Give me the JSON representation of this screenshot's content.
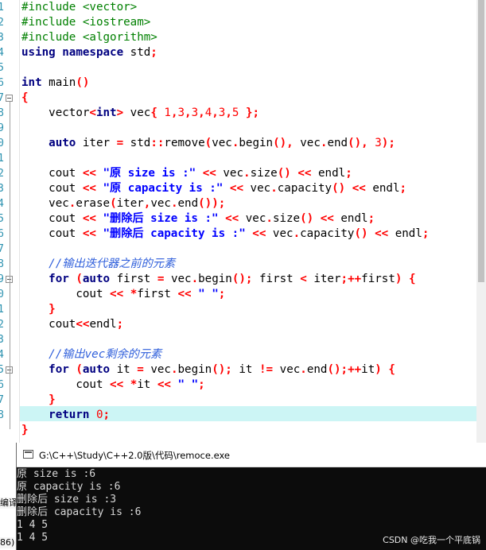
{
  "editor": {
    "lines": [
      [
        [
          "pp",
          "#include <vector>"
        ]
      ],
      [
        [
          "pp",
          "#include <iostream>"
        ]
      ],
      [
        [
          "pp",
          "#include <algorithm>"
        ]
      ],
      [
        [
          "kw",
          "using namespace"
        ],
        [
          "t",
          " std"
        ],
        [
          "op",
          ";"
        ]
      ],
      [],
      [
        [
          "kw",
          "int"
        ],
        [
          "t",
          " main"
        ],
        [
          "op",
          "()"
        ]
      ],
      [
        [
          "op",
          "{"
        ]
      ],
      [
        [
          "t",
          "    vector"
        ],
        [
          "op",
          "<"
        ],
        [
          "kw",
          "int"
        ],
        [
          "op",
          ">"
        ],
        [
          "t",
          " vec"
        ],
        [
          "op",
          "{"
        ],
        [
          "t",
          " "
        ],
        [
          "num",
          "1"
        ],
        [
          "op",
          ","
        ],
        [
          "num",
          "3"
        ],
        [
          "op",
          ","
        ],
        [
          "num",
          "3"
        ],
        [
          "op",
          ","
        ],
        [
          "num",
          "4"
        ],
        [
          "op",
          ","
        ],
        [
          "num",
          "3"
        ],
        [
          "op",
          ","
        ],
        [
          "num",
          "5"
        ],
        [
          "t",
          " "
        ],
        [
          "op",
          "};"
        ]
      ],
      [],
      [
        [
          "t",
          "    "
        ],
        [
          "kw",
          "auto"
        ],
        [
          "t",
          " iter "
        ],
        [
          "op",
          "="
        ],
        [
          "t",
          " std"
        ],
        [
          "op",
          "::"
        ],
        [
          "t",
          "remove"
        ],
        [
          "op",
          "("
        ],
        [
          "t",
          "vec"
        ],
        [
          "op",
          "."
        ],
        [
          "t",
          "begin"
        ],
        [
          "op",
          "(),"
        ],
        [
          "t",
          " vec"
        ],
        [
          "op",
          "."
        ],
        [
          "t",
          "end"
        ],
        [
          "op",
          "(),"
        ],
        [
          "t",
          " "
        ],
        [
          "num",
          "3"
        ],
        [
          "op",
          ");"
        ]
      ],
      [],
      [
        [
          "t",
          "    cout "
        ],
        [
          "op",
          "<<"
        ],
        [
          "t",
          " "
        ],
        [
          "str",
          "\"原 size is :\""
        ],
        [
          "t",
          " "
        ],
        [
          "op",
          "<<"
        ],
        [
          "t",
          " vec"
        ],
        [
          "op",
          "."
        ],
        [
          "t",
          "size"
        ],
        [
          "op",
          "()"
        ],
        [
          "t",
          " "
        ],
        [
          "op",
          "<<"
        ],
        [
          "t",
          " endl"
        ],
        [
          "op",
          ";"
        ]
      ],
      [
        [
          "t",
          "    cout "
        ],
        [
          "op",
          "<<"
        ],
        [
          "t",
          " "
        ],
        [
          "str",
          "\"原 capacity is :\""
        ],
        [
          "t",
          " "
        ],
        [
          "op",
          "<<"
        ],
        [
          "t",
          " vec"
        ],
        [
          "op",
          "."
        ],
        [
          "t",
          "capacity"
        ],
        [
          "op",
          "()"
        ],
        [
          "t",
          " "
        ],
        [
          "op",
          "<<"
        ],
        [
          "t",
          " endl"
        ],
        [
          "op",
          ";"
        ]
      ],
      [
        [
          "t",
          "    vec"
        ],
        [
          "op",
          "."
        ],
        [
          "t",
          "erase"
        ],
        [
          "op",
          "("
        ],
        [
          "t",
          "iter"
        ],
        [
          "op",
          ","
        ],
        [
          "t",
          "vec"
        ],
        [
          "op",
          "."
        ],
        [
          "t",
          "end"
        ],
        [
          "op",
          "());"
        ]
      ],
      [
        [
          "t",
          "    cout "
        ],
        [
          "op",
          "<<"
        ],
        [
          "t",
          " "
        ],
        [
          "str",
          "\"删除后 size is :\""
        ],
        [
          "t",
          " "
        ],
        [
          "op",
          "<<"
        ],
        [
          "t",
          " vec"
        ],
        [
          "op",
          "."
        ],
        [
          "t",
          "size"
        ],
        [
          "op",
          "()"
        ],
        [
          "t",
          " "
        ],
        [
          "op",
          "<<"
        ],
        [
          "t",
          " endl"
        ],
        [
          "op",
          ";"
        ]
      ],
      [
        [
          "t",
          "    cout "
        ],
        [
          "op",
          "<<"
        ],
        [
          "t",
          " "
        ],
        [
          "str",
          "\"删除后 capacity is :\""
        ],
        [
          "t",
          " "
        ],
        [
          "op",
          "<<"
        ],
        [
          "t",
          " vec"
        ],
        [
          "op",
          "."
        ],
        [
          "t",
          "capacity"
        ],
        [
          "op",
          "()"
        ],
        [
          "t",
          " "
        ],
        [
          "op",
          "<<"
        ],
        [
          "t",
          " endl"
        ],
        [
          "op",
          ";"
        ]
      ],
      [],
      [
        [
          "t",
          "    "
        ],
        [
          "cm",
          "//输出迭代器之前的元素"
        ]
      ],
      [
        [
          "t",
          "    "
        ],
        [
          "kw",
          "for"
        ],
        [
          "t",
          " "
        ],
        [
          "op",
          "("
        ],
        [
          "kw",
          "auto"
        ],
        [
          "t",
          " first "
        ],
        [
          "op",
          "="
        ],
        [
          "t",
          " vec"
        ],
        [
          "op",
          "."
        ],
        [
          "t",
          "begin"
        ],
        [
          "op",
          "();"
        ],
        [
          "t",
          " first "
        ],
        [
          "op",
          "<"
        ],
        [
          "t",
          " iter"
        ],
        [
          "op",
          ";++"
        ],
        [
          "t",
          "first"
        ],
        [
          "op",
          ")"
        ],
        [
          "t",
          " "
        ],
        [
          "op",
          "{"
        ]
      ],
      [
        [
          "t",
          "        cout "
        ],
        [
          "op",
          "<<"
        ],
        [
          "t",
          " "
        ],
        [
          "op",
          "*"
        ],
        [
          "t",
          "first "
        ],
        [
          "op",
          "<<"
        ],
        [
          "t",
          " "
        ],
        [
          "str",
          "\" \""
        ],
        [
          "op",
          ";"
        ]
      ],
      [
        [
          "t",
          "    "
        ],
        [
          "op",
          "}"
        ]
      ],
      [
        [
          "t",
          "    cout"
        ],
        [
          "op",
          "<<"
        ],
        [
          "t",
          "endl"
        ],
        [
          "op",
          ";"
        ]
      ],
      [],
      [
        [
          "t",
          "    "
        ],
        [
          "cm",
          "//输出vec剩余的元素"
        ]
      ],
      [
        [
          "t",
          "    "
        ],
        [
          "kw",
          "for"
        ],
        [
          "t",
          " "
        ],
        [
          "op",
          "("
        ],
        [
          "kw",
          "auto"
        ],
        [
          "t",
          " it "
        ],
        [
          "op",
          "="
        ],
        [
          "t",
          " vec"
        ],
        [
          "op",
          "."
        ],
        [
          "t",
          "begin"
        ],
        [
          "op",
          "();"
        ],
        [
          "t",
          " it "
        ],
        [
          "op",
          "!="
        ],
        [
          "t",
          " vec"
        ],
        [
          "op",
          "."
        ],
        [
          "t",
          "end"
        ],
        [
          "op",
          "();++"
        ],
        [
          "t",
          "it"
        ],
        [
          "op",
          ")"
        ],
        [
          "t",
          " "
        ],
        [
          "op",
          "{"
        ]
      ],
      [
        [
          "t",
          "        cout "
        ],
        [
          "op",
          "<<"
        ],
        [
          "t",
          " "
        ],
        [
          "op",
          "*"
        ],
        [
          "t",
          "it "
        ],
        [
          "op",
          "<<"
        ],
        [
          "t",
          " "
        ],
        [
          "str",
          "\" \""
        ],
        [
          "op",
          ";"
        ]
      ],
      [
        [
          "t",
          "    "
        ],
        [
          "op",
          "}"
        ]
      ],
      [
        [
          "t",
          "    "
        ],
        [
          "kw",
          "return"
        ],
        [
          "t",
          " "
        ],
        [
          "num",
          "0"
        ],
        [
          "op",
          ";"
        ]
      ],
      [
        [
          "op",
          "}"
        ]
      ]
    ],
    "gutter_numbers": [
      "1",
      "2",
      "3",
      "4",
      "5",
      "6",
      "7",
      "8",
      "9",
      "0",
      "1",
      "2",
      "3",
      "4",
      "5",
      "6",
      "7",
      "8",
      "9",
      "0",
      "1",
      "2",
      "3",
      "4",
      "5",
      "6",
      "7",
      "8"
    ]
  },
  "side_labels": {
    "compile": "编译",
    "paren": "86)"
  },
  "console": {
    "title": "G:\\C++\\Study\\C++2.0版\\代码\\remoce.exe",
    "output": [
      "原 size is :6",
      "原 capacity is :6",
      "删除后 size is :3",
      "删除后 capacity is :6",
      "1 4 5",
      "1 4 5"
    ]
  },
  "watermark": "CSDN @吃我一个平底锅"
}
